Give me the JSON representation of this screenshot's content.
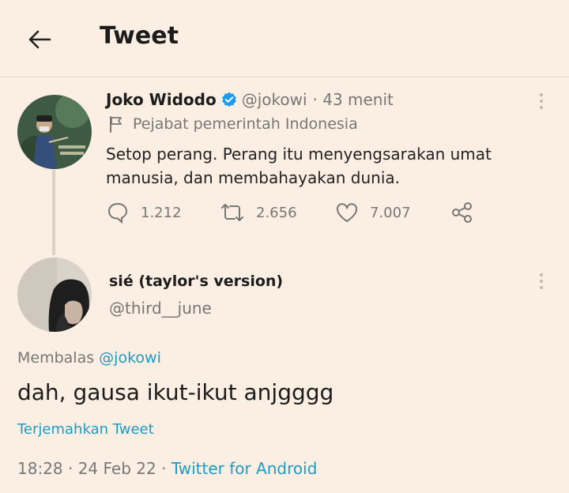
{
  "header": {
    "title": "Tweet",
    "back_icon": "arrow-left-icon"
  },
  "original_tweet": {
    "name": "Joko Widodo",
    "handle": "@jokowi",
    "time": "· 43 menit",
    "label": "Pejabat pemerintah Indonesia",
    "text": "Setop perang. Perang itu menyengsarakan umat manusia, dan membahayakan dunia.",
    "replies": "1.212",
    "retweets": "2.656",
    "likes": "7.007"
  },
  "reply": {
    "name": "sié (taylor's version)",
    "handle": "@third__june",
    "replying_prefix": "Membalas",
    "replying_to": "@jokowi",
    "text": "dah, gausa ikut-ikut anjgggg",
    "translate": "Terjemahkan Tweet",
    "timestamp": "18:28 · 24 Feb 22 ·",
    "source": "Twitter for Android"
  },
  "colors": {
    "background": "#fbeee2",
    "link": "#1d9bc6",
    "verified": "#1d9bf0"
  }
}
